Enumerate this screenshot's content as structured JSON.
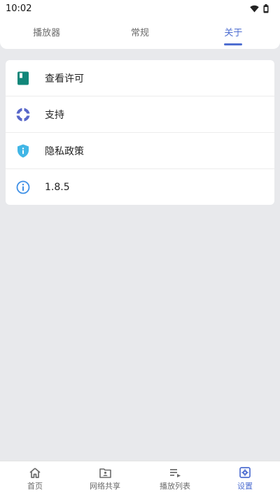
{
  "status_bar": {
    "time": "10:02"
  },
  "tabs": [
    {
      "label": "播放器",
      "active": false
    },
    {
      "label": "常规",
      "active": false
    },
    {
      "label": "关于",
      "active": true
    }
  ],
  "about_items": [
    {
      "label": "查看许可",
      "icon": "license-book-icon",
      "icon_color": "#12877a"
    },
    {
      "label": "支持",
      "icon": "lifebuoy-icon",
      "icon_color": "#5867c9"
    },
    {
      "label": "隐私政策",
      "icon": "privacy-shield-icon",
      "icon_color": "#41b6e6"
    },
    {
      "label": "1.8.5",
      "icon": "info-icon",
      "icon_color": "#3d8fe6"
    }
  ],
  "bottom_nav": [
    {
      "label": "首页",
      "icon": "home-icon",
      "active": false
    },
    {
      "label": "网络共享",
      "icon": "network-share-icon",
      "active": false
    },
    {
      "label": "播放列表",
      "icon": "playlist-icon",
      "active": false
    },
    {
      "label": "设置",
      "icon": "settings-icon",
      "active": true
    }
  ],
  "colors": {
    "accent": "#4f6fd1",
    "background": "#e8e9ec"
  }
}
